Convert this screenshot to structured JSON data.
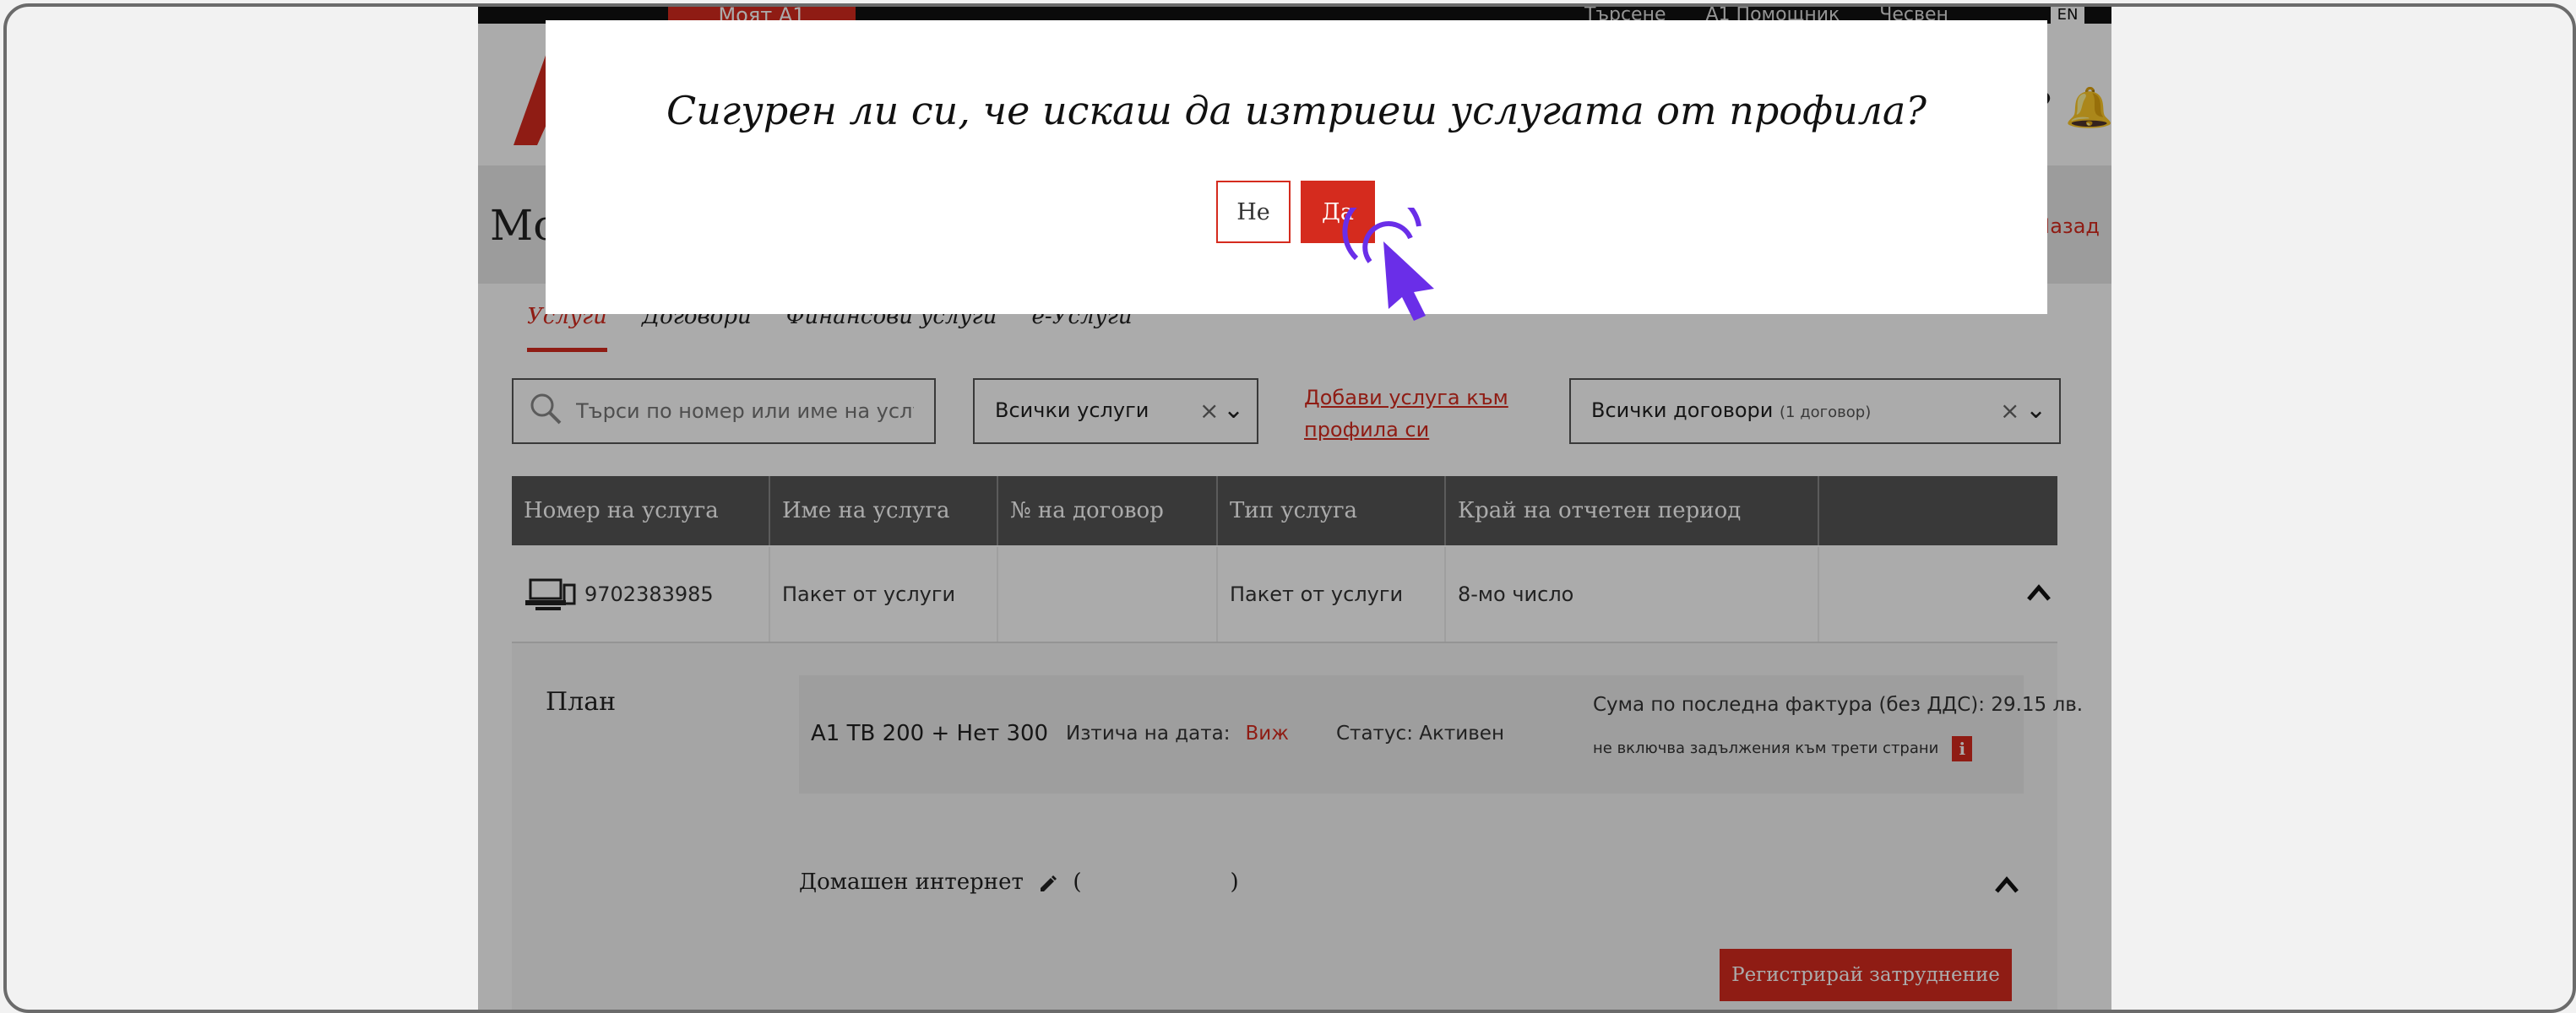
{
  "header": {
    "my_a1": "Моят А1",
    "top_links": [
      "Търсене",
      "А1 Помощник",
      "Чесвен"
    ],
    "lang": "EN"
  },
  "page": {
    "title": "Мо",
    "back_link": "Назад"
  },
  "tabs": [
    {
      "label": "Услуги",
      "active": true
    },
    {
      "label": "Договори",
      "active": false
    },
    {
      "label": "Финансови услуги",
      "active": false
    },
    {
      "label": "е-Услуги",
      "active": false
    }
  ],
  "filters": {
    "search_placeholder": "Търси по номер или име на услуга",
    "services_select": "Всички услуги",
    "add_service_link": "Добави услуга към профила си",
    "contracts_select": "Всички договори",
    "contracts_count": "(1 договор)"
  },
  "table": {
    "headers": [
      "Номер на услуга",
      "Име на услуга",
      "№ на договор",
      "Тип услуга",
      "Край на отчетен период",
      ""
    ],
    "row": {
      "number": "9702383985",
      "name": "Пакет от услуги",
      "contract": "",
      "type": "Пакет от услуги",
      "period_end": "8-мо число"
    }
  },
  "plan": {
    "label": "План",
    "name": "A1 TB 200 + Нет 300",
    "expire_label": "Изтича на дата:",
    "expire_link": "Виж",
    "status": "Статус: Активен",
    "invoice_sum": "Сума по последна фактура (без ДДС): 29.15 лв.",
    "note": "не включва задължения към трети страни",
    "info_icon": "i"
  },
  "internet": {
    "label": "Домашен интернет",
    "paren_open": "(",
    "paren_close": ")"
  },
  "register_button": "Регистрирай затруднение",
  "modal": {
    "question": "Сигурен ли си, че искаш да изтриеш услугата от профила?",
    "no_label": "Не",
    "yes_label": "Да"
  },
  "colors": {
    "brand_red": "#d52b1e",
    "cursor_purple": "#6a2ee8"
  }
}
